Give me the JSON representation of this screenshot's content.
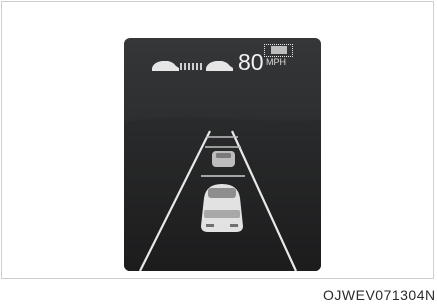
{
  "cluster": {
    "speed_value": "80",
    "speed_unit": "MPH",
    "icons": [
      "lead-car-icon",
      "following-distance-bars-icon",
      "own-car-icon",
      "set-speed-box-icon"
    ]
  },
  "figure_code": "OJWEV071304N"
}
